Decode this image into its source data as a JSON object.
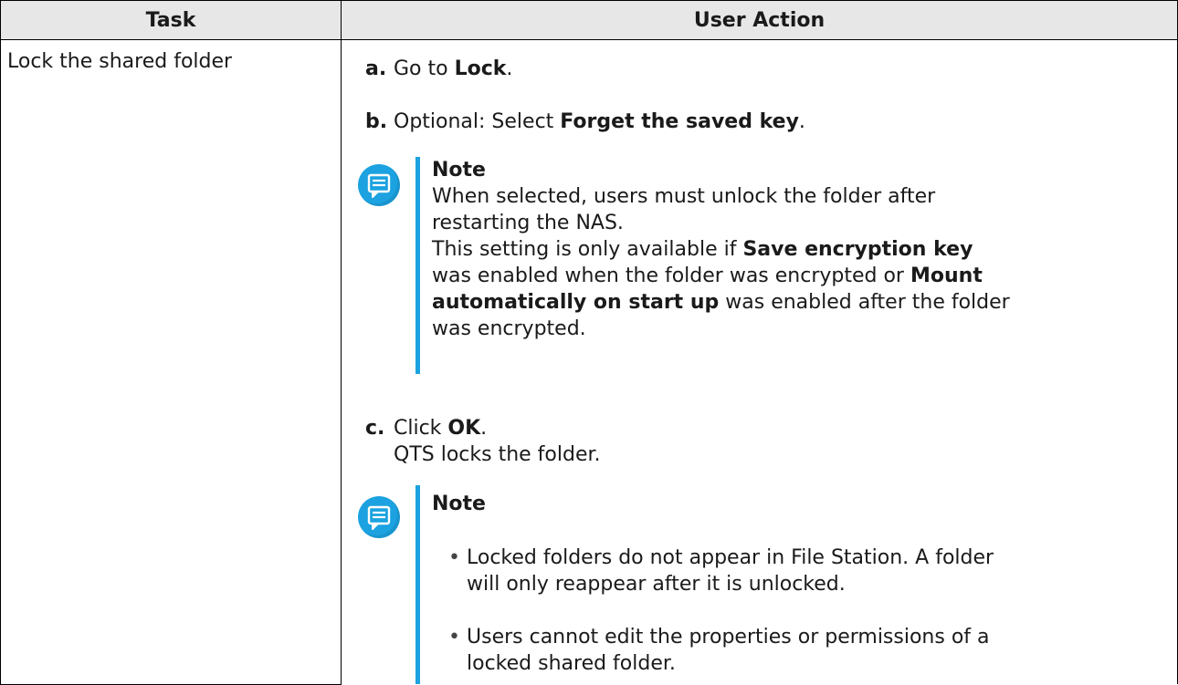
{
  "table": {
    "headers": {
      "task": "Task",
      "user_action": "User Action"
    },
    "row": {
      "task": "Lock the shared folder",
      "steps": [
        {
          "letter": "a.",
          "pre": "Go to ",
          "bold": "Lock",
          "post": "."
        },
        {
          "letter": "b.",
          "pre": "Optional: Select ",
          "bold": "Forget the saved key",
          "post": "."
        },
        {
          "letter": "c.",
          "pre": "Click ",
          "bold": "OK",
          "post": ".",
          "sub": "QTS locks the folder."
        }
      ],
      "note1": {
        "title": "Note",
        "line1": "When selected, users must unlock the folder after",
        "line2": "restarting the NAS.",
        "p1": "This setting is only available if ",
        "b1": "Save encryption key",
        "p2": "was enabled when the folder was encrypted or ",
        "b2": "Mount",
        "b3": "automatically on start up",
        "p3": " was enabled after the folder",
        "p4": "was encrypted."
      },
      "note2": {
        "title": "Note",
        "bullets": [
          {
            "l1": "Locked folders do not appear in File Station. A folder",
            "l2": "will only reappear after it is unlocked."
          },
          {
            "l1": "Users cannot edit the properties or permissions of a",
            "l2": "locked shared folder."
          }
        ]
      }
    }
  },
  "colors": {
    "accent": "#1ca2e0",
    "header_bg": "#e7e7e7"
  },
  "icons": {
    "note": "note-speech-bubble-icon"
  }
}
